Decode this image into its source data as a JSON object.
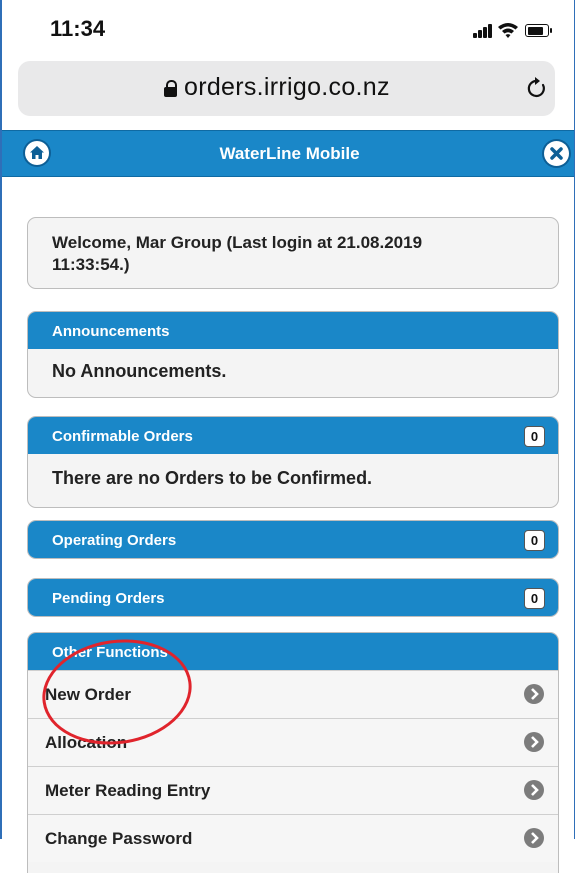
{
  "status_bar": {
    "time": "11:34"
  },
  "browser": {
    "url": "orders.irrigo.co.nz"
  },
  "header": {
    "title": "WaterLine Mobile"
  },
  "welcome": {
    "text": "Welcome, Mar Group (Last login at 21.08.2019 11:33:54.)"
  },
  "announcements": {
    "title": "Announcements",
    "body": "No Announcements."
  },
  "confirmable_orders": {
    "title": "Confirmable Orders",
    "count": "0",
    "body": "There are no Orders to be Confirmed."
  },
  "operating_orders": {
    "title": "Operating Orders",
    "count": "0"
  },
  "pending_orders": {
    "title": "Pending Orders",
    "count": "0"
  },
  "other_functions": {
    "title": "Other Functions",
    "items": [
      {
        "label": "New Order"
      },
      {
        "label": "Allocation"
      },
      {
        "label": "Meter Reading Entry"
      },
      {
        "label": "Change Password"
      }
    ]
  },
  "colors": {
    "accent": "#1a87c8",
    "annotation": "#e0242c",
    "panel_bg": "#f4f4f4"
  }
}
